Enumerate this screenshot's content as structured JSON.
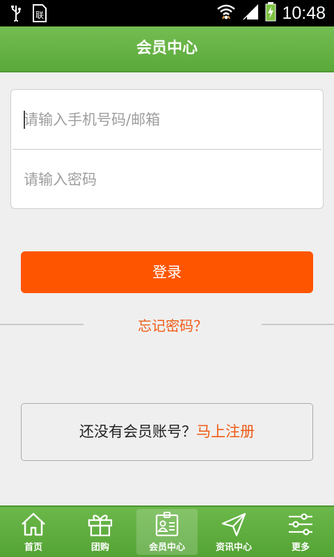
{
  "status_bar": {
    "time": "10:48",
    "icons": [
      "usb-icon",
      "sim-icon",
      "wifi-icon",
      "signal-icon",
      "battery-charging-icon"
    ]
  },
  "header": {
    "title": "会员中心"
  },
  "login_form": {
    "phone_placeholder": "请输入手机号码/邮箱",
    "password_placeholder": "请输入密码",
    "login_button": "登录",
    "forgot_password": "忘记密码？"
  },
  "register": {
    "prompt": "还没有会员账号？",
    "link": "马上注册"
  },
  "bottom_nav": {
    "active_index": 2,
    "items": [
      {
        "label": "首页",
        "icon": "home-icon"
      },
      {
        "label": "团购",
        "icon": "gift-icon"
      },
      {
        "label": "会员中心",
        "icon": "member-card-icon"
      },
      {
        "label": "资讯中心",
        "icon": "send-icon"
      },
      {
        "label": "更多",
        "icon": "sliders-icon"
      }
    ]
  },
  "colors": {
    "header_green": "#5aa93a",
    "accent_orange": "#fe5500",
    "link_orange": "#ef5a14",
    "background": "#efefef"
  }
}
